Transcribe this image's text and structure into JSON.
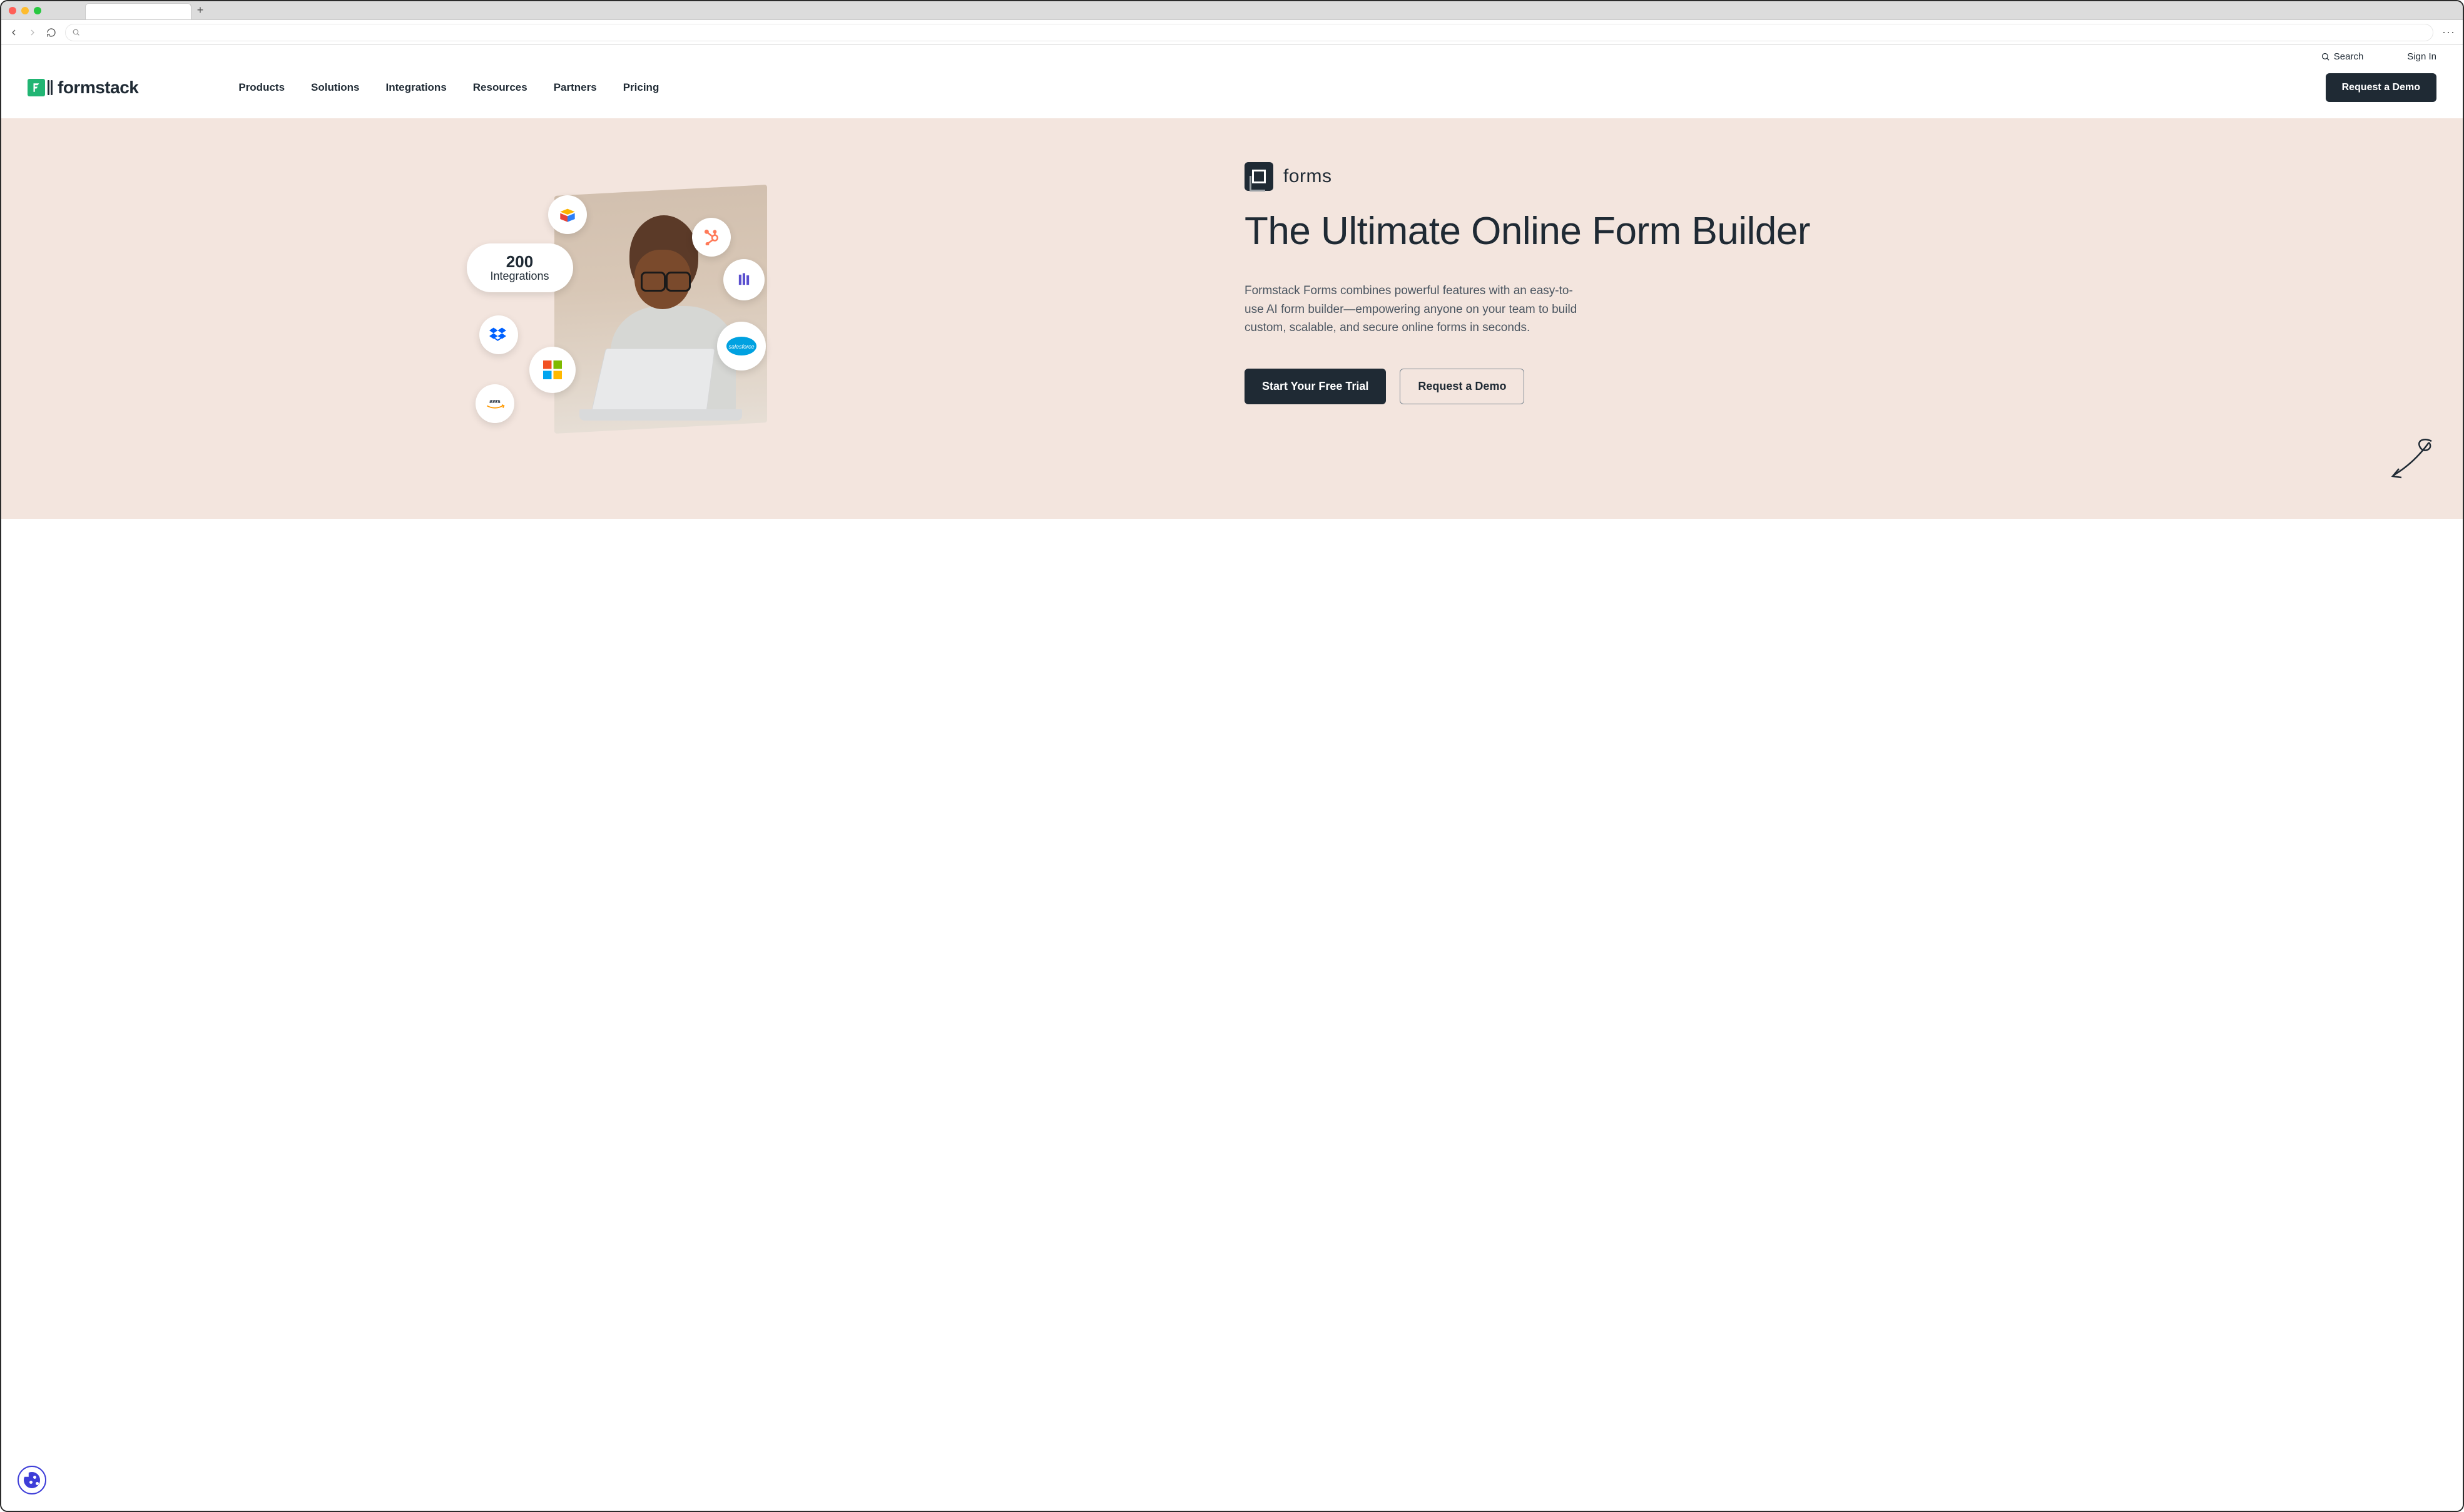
{
  "browser": {
    "new_tab_glyph": "+",
    "more_glyph": "···"
  },
  "utility": {
    "search_label": "Search",
    "signin_label": "Sign In"
  },
  "logo_text": "formstack",
  "nav_items": [
    "Products",
    "Solutions",
    "Integrations",
    "Resources",
    "Partners",
    "Pricing"
  ],
  "nav_cta": "Request a Demo",
  "hero": {
    "badge_number": "200",
    "badge_label": "Integrations",
    "integration_bubbles": {
      "airtable": "airtable",
      "hubspot": "hubspot",
      "intercom": "intercom",
      "salesforce": "salesforce",
      "dropbox": "dropbox",
      "microsoft": "microsoft",
      "aws": "aws"
    },
    "product_name": "forms",
    "title": "The Ultimate Online Form Builder",
    "description": "Formstack Forms combines powerful features with an easy-to-use AI form builder—empowering anyone on your team to build custom, scalable, and secure online forms in seconds.",
    "cta_primary": "Start Your Free Trial",
    "cta_secondary": "Request a Demo"
  }
}
